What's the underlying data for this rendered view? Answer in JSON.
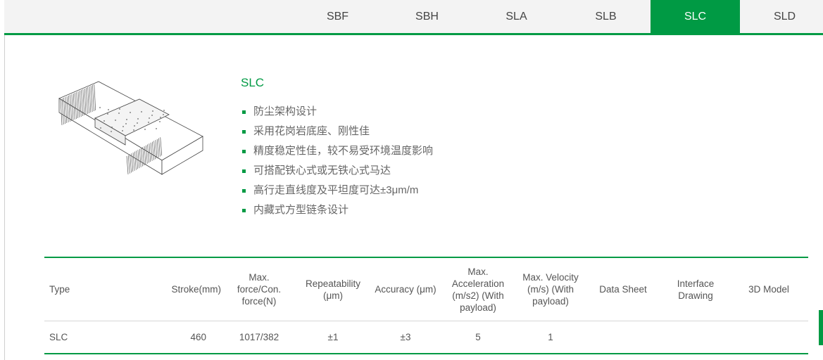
{
  "tabs": [
    {
      "label": "SBF",
      "active": false
    },
    {
      "label": "SBH",
      "active": false
    },
    {
      "label": "SLA",
      "active": false
    },
    {
      "label": "SLB",
      "active": false
    },
    {
      "label": "SLC",
      "active": true
    },
    {
      "label": "SLD",
      "active": false
    }
  ],
  "product": {
    "title": "SLC",
    "image": "linear-stage-product-image",
    "features": [
      "防尘架构设计",
      "采用花岗岩底座、刚性佳",
      "精度稳定性佳，较不易受环境温度影响",
      "可搭配铁心式或无铁心式马达",
      "高行走直线度及平坦度可达±3μm/m",
      "内藏式方型链条设计"
    ]
  },
  "spec_table": {
    "headers": [
      "Type",
      "Stroke(mm)",
      "Max. force/Con. force(N)",
      "Repeatability (μm)",
      "Accuracy (μm)",
      "Max. Acceleration (m/s2) (With payload)",
      "Max. Velocity (m/s) (With payload)",
      "Data Sheet",
      "Interface Drawing",
      "3D Model"
    ],
    "rows": [
      [
        "SLC",
        "460",
        "1017/382",
        "±1",
        "±3",
        "5",
        "1",
        "",
        "",
        ""
      ]
    ]
  },
  "colors": {
    "accent": "#009a44",
    "tabbar_bg": "#f3f3f3"
  }
}
